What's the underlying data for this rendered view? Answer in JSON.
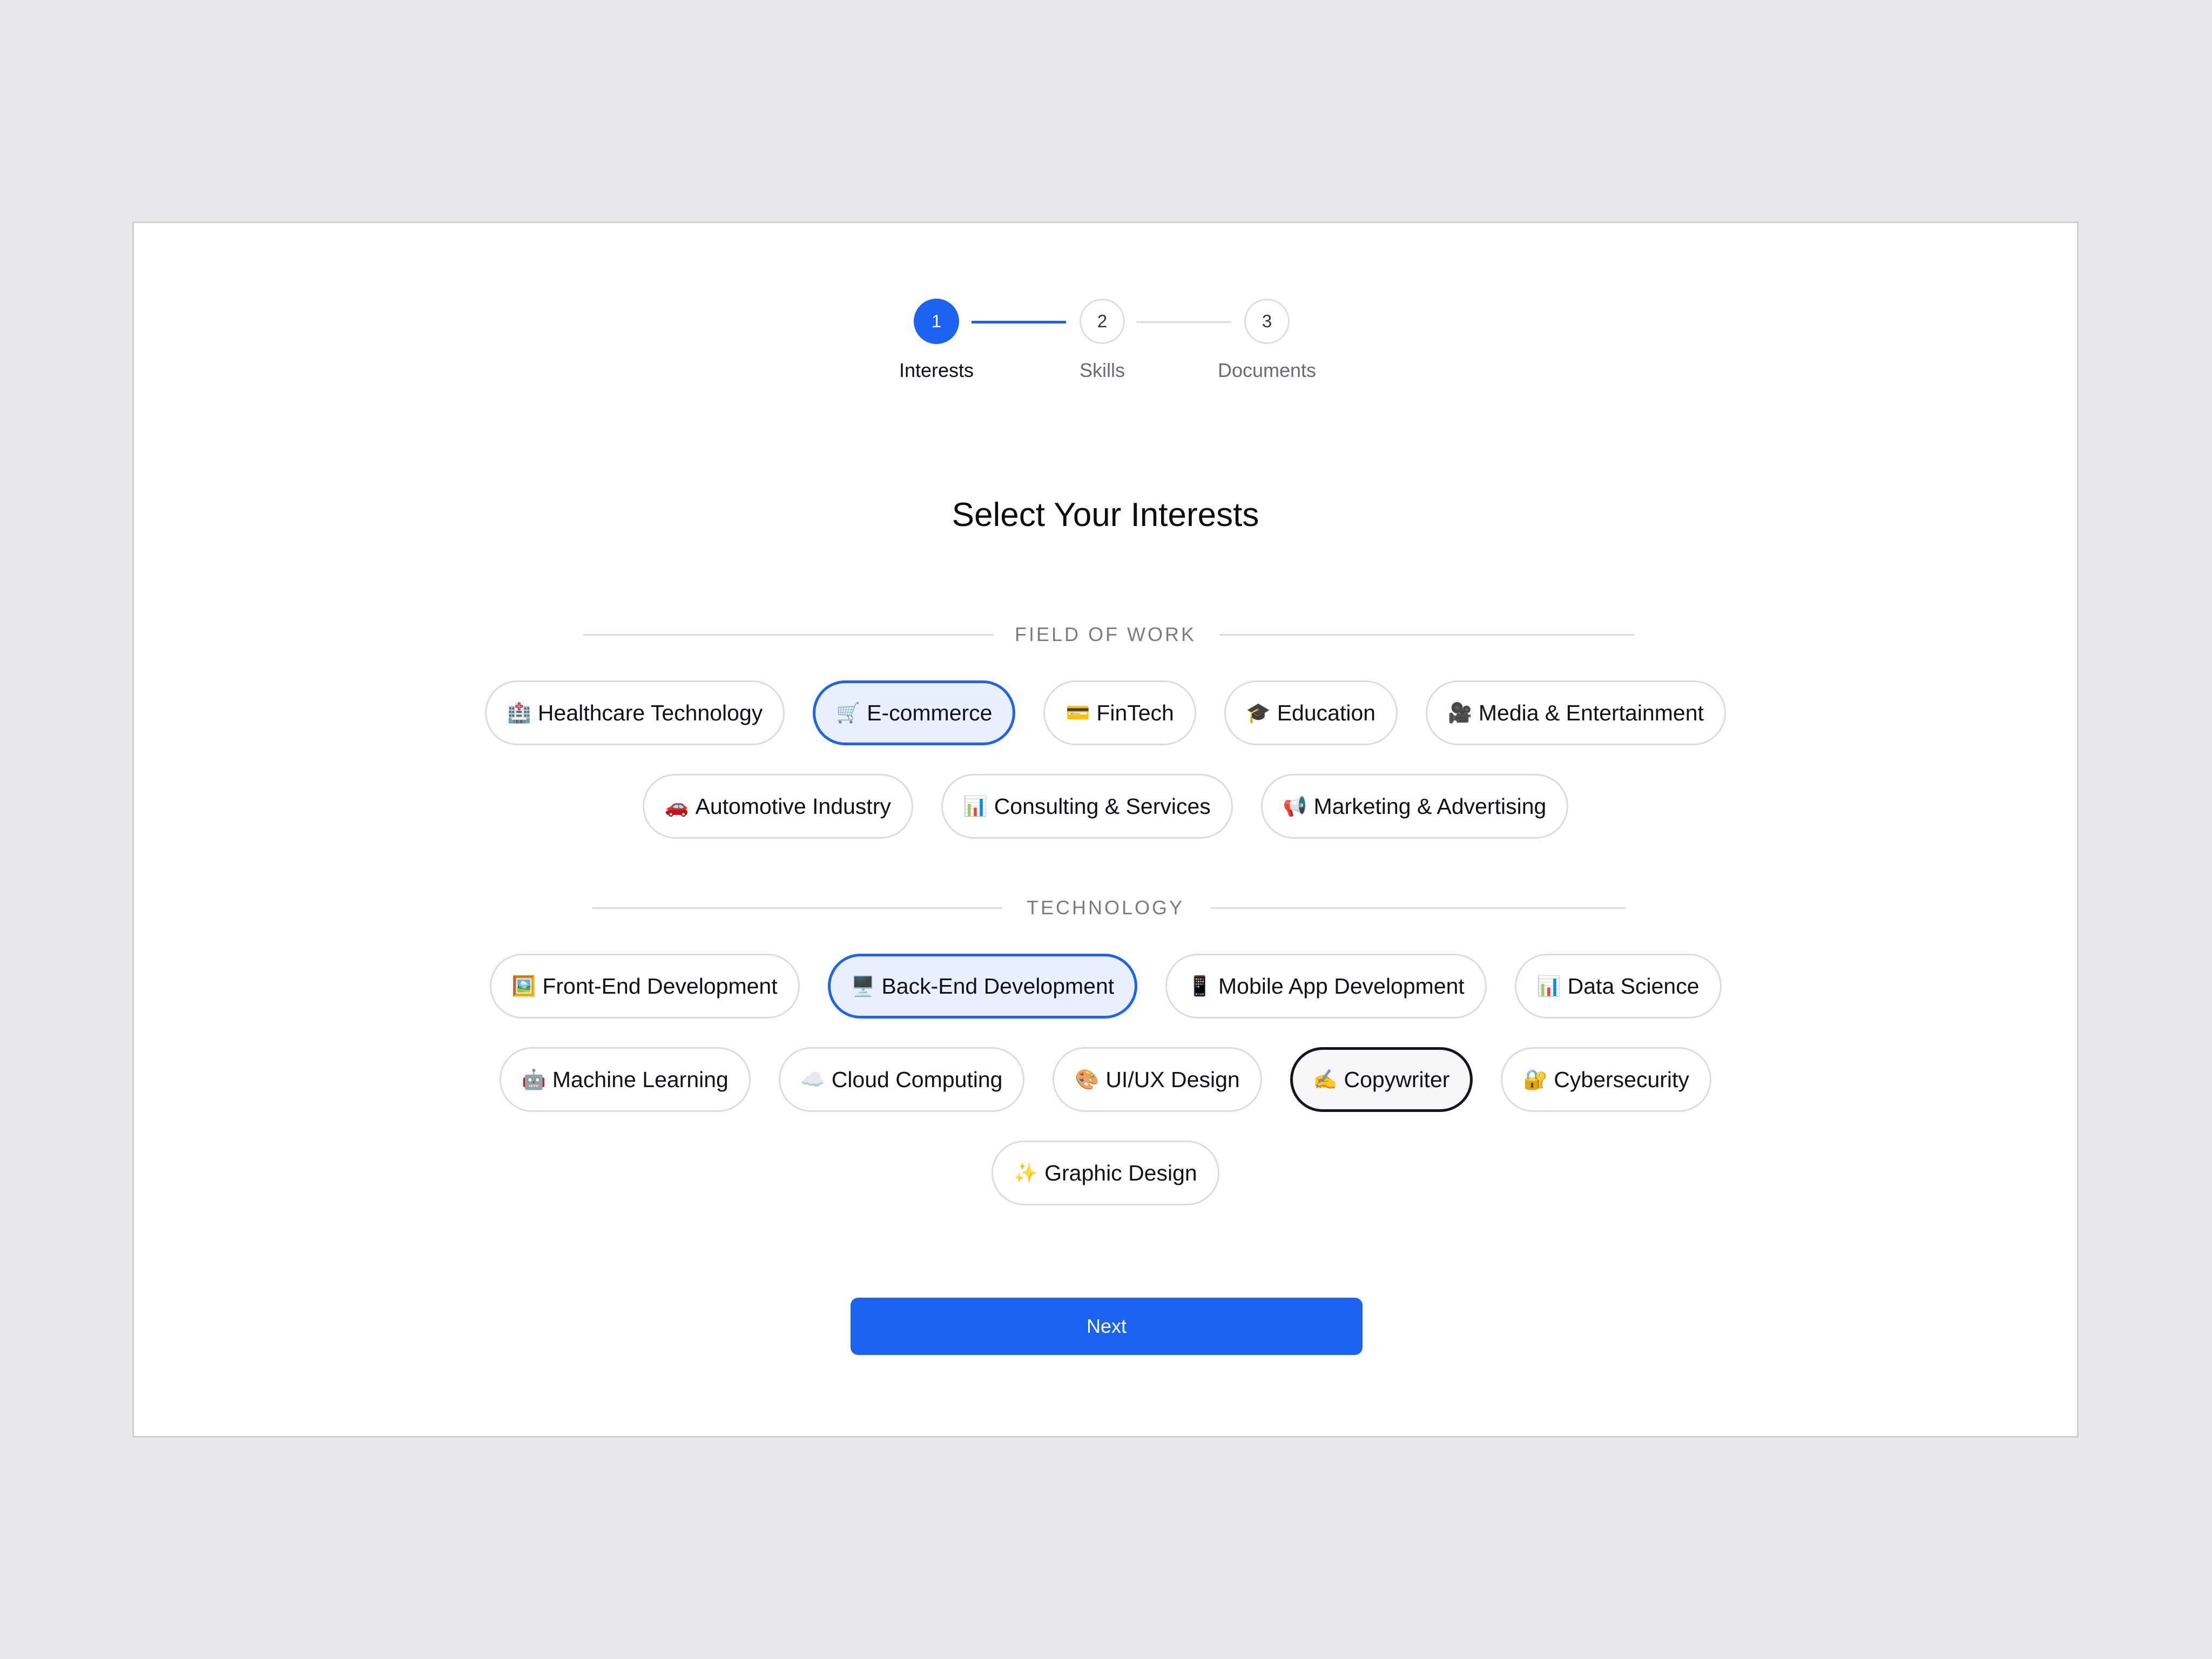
{
  "stepper": {
    "steps": [
      {
        "number": "1",
        "label": "Interests",
        "state": "active"
      },
      {
        "number": "2",
        "label": "Skills",
        "state": "upcoming"
      },
      {
        "number": "3",
        "label": "Documents",
        "state": "upcoming"
      }
    ],
    "colors": {
      "active": "#1b63f0",
      "inactive": "#dedde3"
    }
  },
  "page_title": "Select Your Interests",
  "sections": [
    {
      "label": "FIELD OF WORK",
      "chips": [
        {
          "icon": "🏥",
          "icon_name": "hospital-icon",
          "label": "Healthcare Technology",
          "state": "default"
        },
        {
          "icon": "🛒",
          "icon_name": "shopping-cart-icon",
          "label": "E-commerce",
          "state": "selected"
        },
        {
          "icon": "💳",
          "icon_name": "credit-card-icon",
          "label": "FinTech",
          "state": "default"
        },
        {
          "icon": "🎓",
          "icon_name": "graduation-cap-icon",
          "label": "Education",
          "state": "default"
        },
        {
          "icon": "🎥",
          "icon_name": "movie-camera-icon",
          "label": "Media & Entertainment",
          "state": "default"
        },
        {
          "icon": "🚗",
          "icon_name": "car-icon",
          "label": "Automotive Industry",
          "state": "default"
        },
        {
          "icon": "📊",
          "icon_name": "bar-chart-icon",
          "label": "Consulting & Services",
          "state": "default"
        },
        {
          "icon": "📢",
          "icon_name": "megaphone-icon",
          "label": "Marketing & Advertising",
          "state": "default"
        }
      ]
    },
    {
      "label": "TECHNOLOGY",
      "chips": [
        {
          "icon": "🖼️",
          "icon_name": "framed-picture-icon",
          "label": "Front-End Development",
          "state": "default"
        },
        {
          "icon": "🖥️",
          "icon_name": "desktop-computer-icon",
          "label": "Back-End Development",
          "state": "selected"
        },
        {
          "icon": "📱",
          "icon_name": "mobile-phone-icon",
          "label": "Mobile App Development",
          "state": "default"
        },
        {
          "icon": "📊",
          "icon_name": "bar-chart-icon",
          "label": "Data Science",
          "state": "default"
        },
        {
          "icon": "🤖",
          "icon_name": "robot-icon",
          "label": "Machine Learning",
          "state": "default"
        },
        {
          "icon": "☁️",
          "icon_name": "cloud-icon",
          "label": "Cloud Computing",
          "state": "default"
        },
        {
          "icon": "🎨",
          "icon_name": "palette-icon",
          "label": "UI/UX Design",
          "state": "default"
        },
        {
          "icon": "✍️",
          "icon_name": "writing-hand-icon",
          "label": "Copywriter",
          "state": "focused"
        },
        {
          "icon": "🔐",
          "icon_name": "lock-with-key-icon",
          "label": "Cybersecurity",
          "state": "default"
        },
        {
          "icon": "✨",
          "icon_name": "sparkles-icon",
          "label": "Graphic Design",
          "state": "default"
        }
      ]
    }
  ],
  "next_button": {
    "label": "Next"
  },
  "colors": {
    "accent": "#1b63f0",
    "selected_bg": "#e9effd",
    "background": "#e9e8ec"
  }
}
